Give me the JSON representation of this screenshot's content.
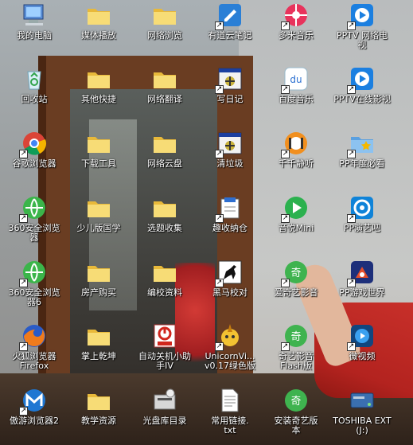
{
  "desktop": {
    "icons": [
      {
        "label": "我的电脑",
        "icon": "computer-icon"
      },
      {
        "label": "媒体播放",
        "icon": "folder-icon"
      },
      {
        "label": "网络浏览",
        "icon": "folder-icon"
      },
      {
        "label": "有道云笔记",
        "icon": "youdao-note-icon"
      },
      {
        "label": "多米音乐",
        "icon": "duomi-music-icon"
      },
      {
        "label": "PPTV 网络电\n视",
        "icon": "pptv-icon"
      },
      {
        "label": "回收站",
        "icon": "recycle-bin-icon"
      },
      {
        "label": "其他快捷",
        "icon": "folder-icon"
      },
      {
        "label": "网络翻译",
        "icon": "folder-icon"
      },
      {
        "label": "写日记",
        "icon": "app-window-icon"
      },
      {
        "label": "百度音乐",
        "icon": "baidu-music-icon"
      },
      {
        "label": "PPTV在线影视",
        "icon": "pptv-icon"
      },
      {
        "label": "谷歌浏览器",
        "icon": "chrome-icon"
      },
      {
        "label": "下载工具",
        "icon": "folder-icon"
      },
      {
        "label": "网络云盘",
        "icon": "folder-icon"
      },
      {
        "label": "清垃圾",
        "icon": "app-window-icon"
      },
      {
        "label": "千千静听",
        "icon": "ttplayer-icon"
      },
      {
        "label": "PP年度必看",
        "icon": "star-folder-icon"
      },
      {
        "label": "360安全浏览\n器",
        "icon": "browser-360-icon"
      },
      {
        "label": "少儿版国学",
        "icon": "folder-icon"
      },
      {
        "label": "选题收集",
        "icon": "folder-icon"
      },
      {
        "label": "趣收纳仓",
        "icon": "storage-icon"
      },
      {
        "label": "音悦Mini",
        "icon": "yinyue-icon"
      },
      {
        "label": "PP演艺吧",
        "icon": "pptv-show-icon"
      },
      {
        "label": "360安全浏览\n器6",
        "icon": "browser-360-icon"
      },
      {
        "label": "房产购买",
        "icon": "folder-icon"
      },
      {
        "label": "编校资料",
        "icon": "folder-icon"
      },
      {
        "label": "黑马校对",
        "icon": "heima-icon"
      },
      {
        "label": "爱奇艺影音",
        "icon": "iqiyi-icon"
      },
      {
        "label": "PP游戏世界",
        "icon": "pp-game-icon"
      },
      {
        "label": "火狐浏览器\nFirefox",
        "icon": "firefox-icon"
      },
      {
        "label": "掌上乾坤",
        "icon": "folder-icon"
      },
      {
        "label": "自动关机小助\n手IV",
        "icon": "auto-shutdown-icon"
      },
      {
        "label": "UnicornVi...\nv0.17绿色版",
        "icon": "unicorn-icon"
      },
      {
        "label": "奇艺影音\nFlash版",
        "icon": "iqiyi-icon"
      },
      {
        "label": "微视频",
        "icon": "micro-video-icon"
      },
      {
        "label": "傲游浏览器2",
        "icon": "maxthon-icon"
      },
      {
        "label": "教学资源",
        "icon": "folder-icon"
      },
      {
        "label": "光盘库目录",
        "icon": "disc-library-icon"
      },
      {
        "label": "常用链接.\ntxt",
        "icon": "text-file-icon"
      },
      {
        "label": "安装奇艺版\n本",
        "icon": "iqiyi-icon"
      },
      {
        "label": "TOSHIBA EXT\n(J:)",
        "icon": "drive-icon"
      }
    ]
  },
  "colors": {
    "label_text": "#ffffff",
    "folder": "#f3d36b",
    "accent_blue": "#1e7fd8"
  }
}
